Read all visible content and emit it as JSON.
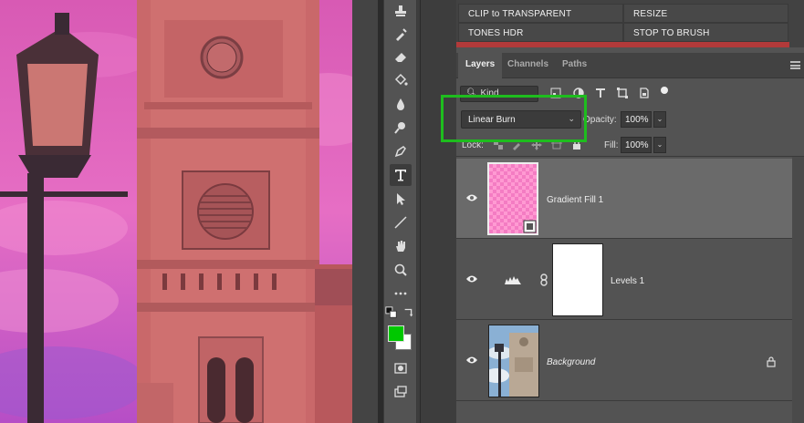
{
  "actions": {
    "row1": [
      "CLIP to TRANSPARENT",
      "RESIZE"
    ],
    "row2": [
      "TONES HDR",
      "STOP TO BRUSH"
    ]
  },
  "tabs": [
    {
      "label": "Layers",
      "active": true
    },
    {
      "label": "Channels",
      "active": false
    },
    {
      "label": "Paths",
      "active": false
    }
  ],
  "filter": {
    "kind_label": "Kind"
  },
  "blend": {
    "mode": "Linear Burn",
    "opacity_label": "Opacity:",
    "opacity_value": "100%",
    "lock_label": "Lock:",
    "fill_label": "Fill:",
    "fill_value": "100%"
  },
  "layers": [
    {
      "name": "Gradient Fill 1",
      "selected": true,
      "visible": true,
      "italic": false
    },
    {
      "name": "Levels 1",
      "selected": false,
      "visible": true,
      "italic": false
    },
    {
      "name": "Background",
      "selected": false,
      "visible": true,
      "italic": true,
      "locked": true
    }
  ],
  "colors": {
    "foreground": "#00c800",
    "background": "#ffffff",
    "highlight": "#1ebd1e",
    "gradient_tint": "#ff80c8"
  },
  "tools": [
    "stamp-icon",
    "healing-brush-icon",
    "eraser-icon",
    "paint-bucket-icon",
    "blur-icon",
    "dodge-icon",
    "pen-icon",
    "type-icon",
    "path-select-icon",
    "line-icon",
    "hand-icon",
    "zoom-icon",
    "more-tools-icon"
  ]
}
